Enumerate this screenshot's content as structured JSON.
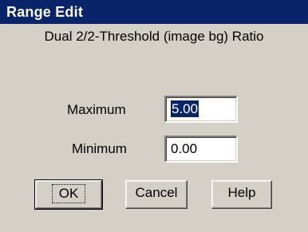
{
  "window": {
    "title": "Range Edit"
  },
  "subtitle": "Dual 2/2-Threshold (image bg) Ratio",
  "fields": {
    "maximum": {
      "label": "Maximum",
      "value": "5.00"
    },
    "minimum": {
      "label": "Minimum",
      "value": "0.00"
    }
  },
  "buttons": {
    "ok": "OK",
    "cancel": "Cancel",
    "help": "Help"
  },
  "colors": {
    "titlebar": "#0a246a",
    "dialog_bg": "#d4d0c8",
    "selection": "#0a246a"
  }
}
